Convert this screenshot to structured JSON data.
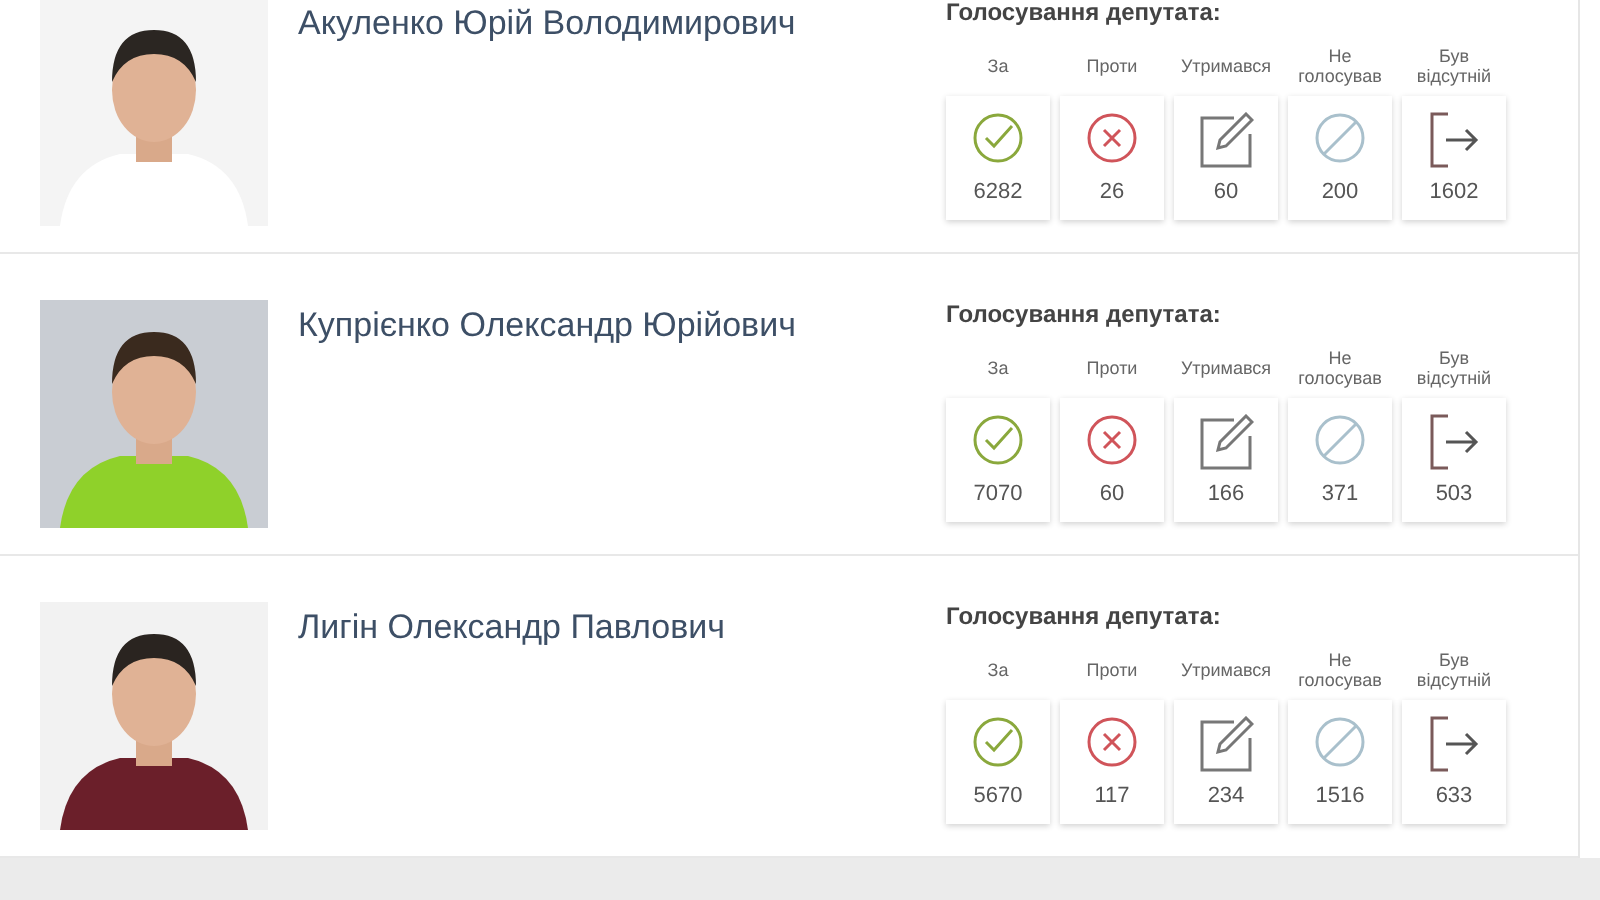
{
  "deputies": [
    {
      "name": "Акуленко Юрій Володимирович",
      "votes_heading": "Голосування депутата:",
      "votes": [
        {
          "kind": "for",
          "label": "За",
          "count": "6282"
        },
        {
          "kind": "against",
          "label": "Проти",
          "count": "26"
        },
        {
          "kind": "abstain",
          "label": "Утримався",
          "count": "60"
        },
        {
          "kind": "not_voted",
          "label": "Не голосував",
          "count": "200"
        },
        {
          "kind": "absent",
          "label": "Був відсутній",
          "count": "1602"
        }
      ]
    },
    {
      "name": "Купрієнко Олександр Юрійович",
      "votes_heading": "Голосування депутата:",
      "votes": [
        {
          "kind": "for",
          "label": "За",
          "count": "7070"
        },
        {
          "kind": "against",
          "label": "Проти",
          "count": "60"
        },
        {
          "kind": "abstain",
          "label": "Утримався",
          "count": "166"
        },
        {
          "kind": "not_voted",
          "label": "Не голосував",
          "count": "371"
        },
        {
          "kind": "absent",
          "label": "Був відсутній",
          "count": "503"
        }
      ]
    },
    {
      "name": "Лигін Олександр Павлович",
      "votes_heading": "Голосування депутата:",
      "votes": [
        {
          "kind": "for",
          "label": "За",
          "count": "5670"
        },
        {
          "kind": "against",
          "label": "Проти",
          "count": "117"
        },
        {
          "kind": "abstain",
          "label": "Утримався",
          "count": "234"
        },
        {
          "kind": "not_voted",
          "label": "Не голосував",
          "count": "1516"
        },
        {
          "kind": "absent",
          "label": "Був відсутній",
          "count": "633"
        }
      ]
    }
  ]
}
